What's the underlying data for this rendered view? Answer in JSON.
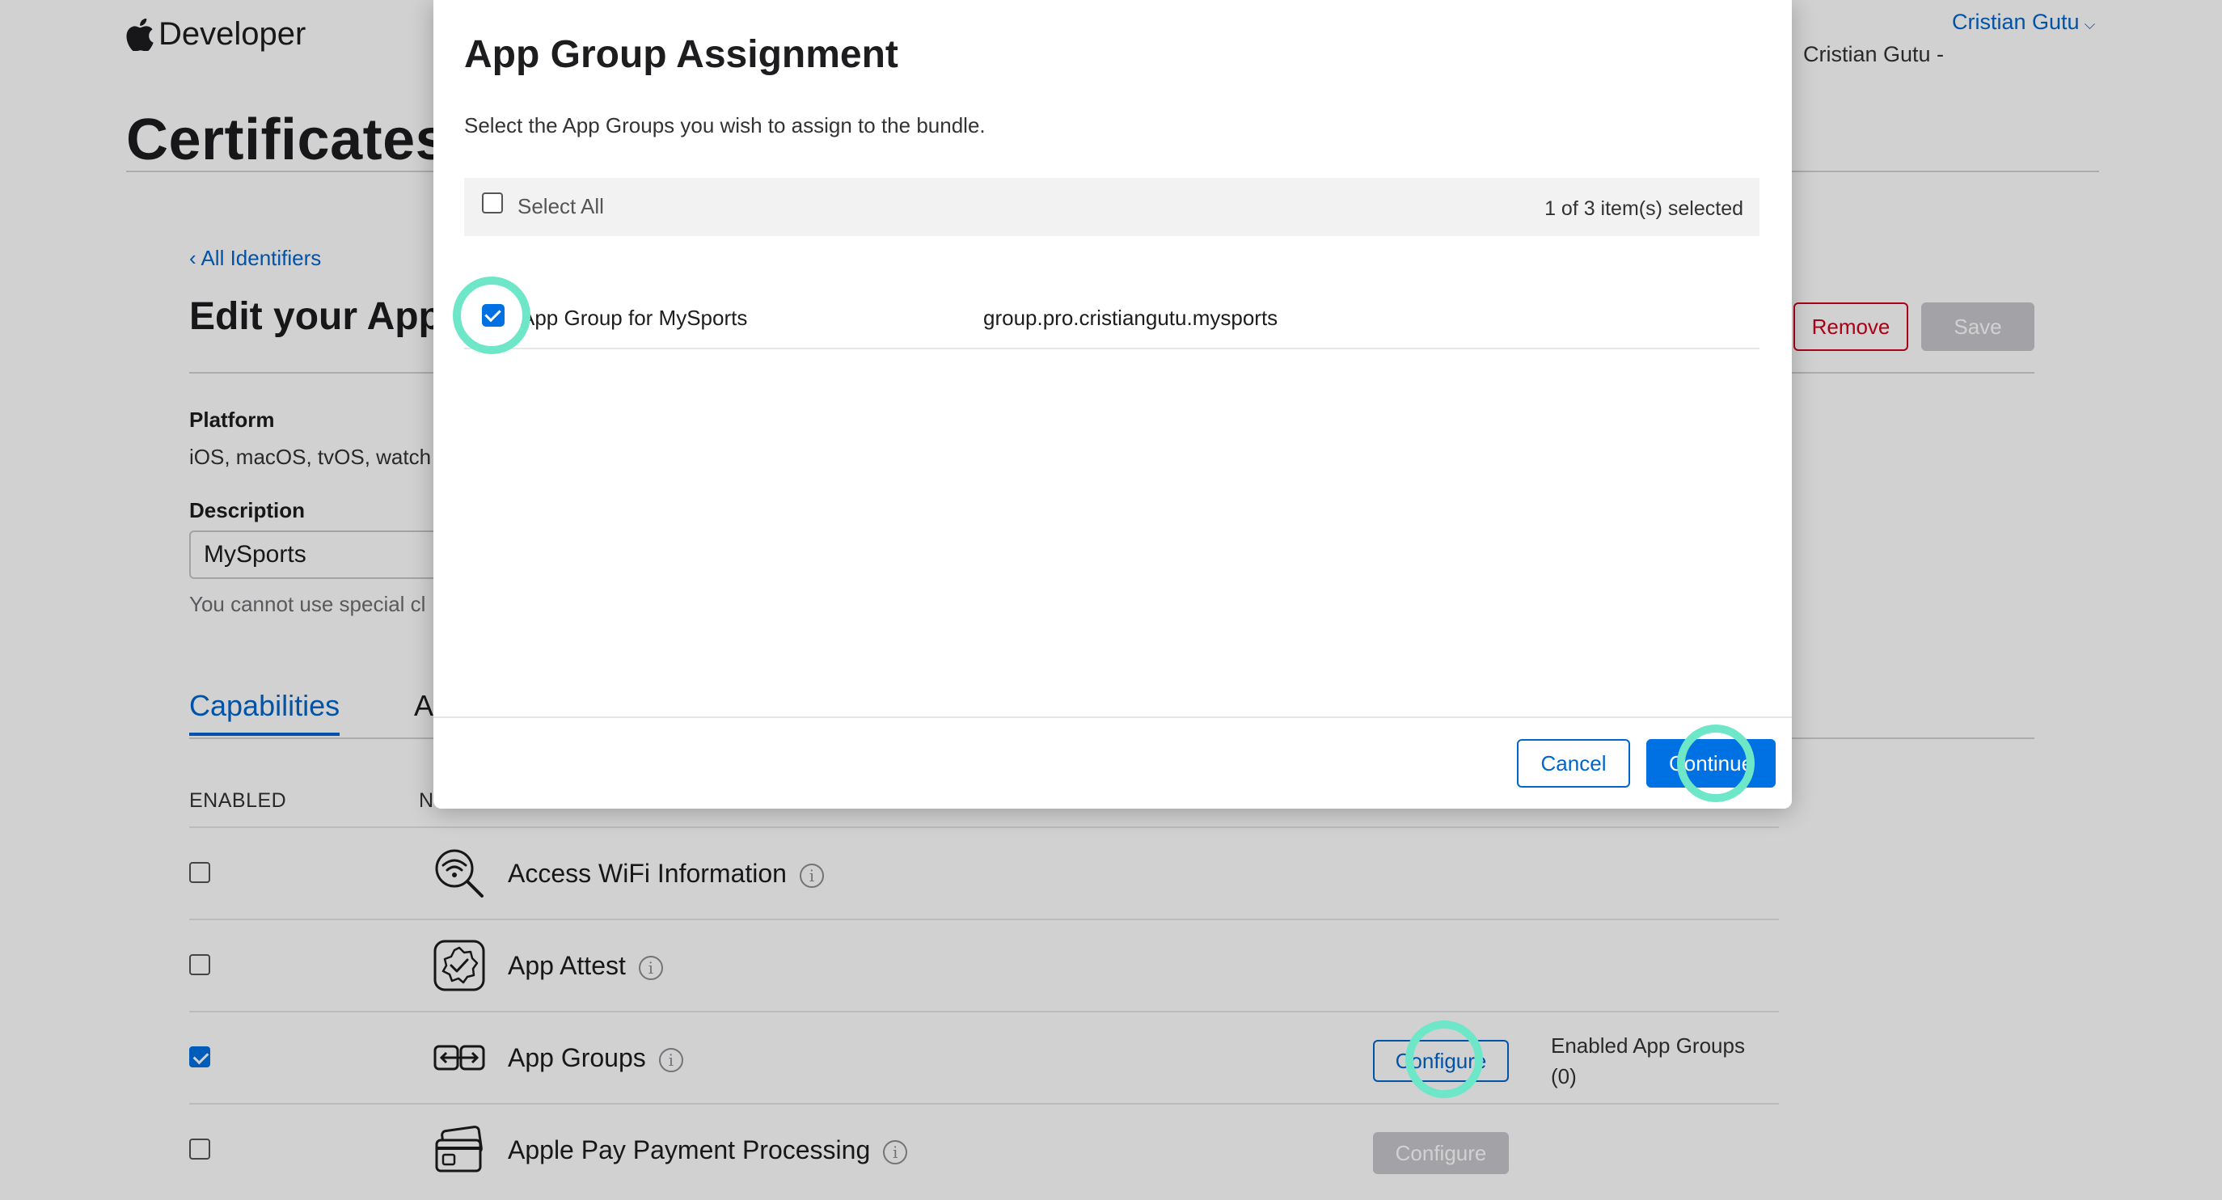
{
  "header": {
    "brand": "Developer",
    "user_name": "Cristian Gutu",
    "user_team": "Cristian Gutu -"
  },
  "page": {
    "title": "Certificates",
    "back_link": "‹ All Identifiers",
    "section_title": "Edit your App",
    "remove_label": "Remove",
    "save_label": "Save",
    "platform_label": "Platform",
    "platform_value": "iOS, macOS, tvOS, watch",
    "description_label": "Description",
    "description_value": "MySports",
    "description_hint": "You cannot use special cl",
    "tabs": [
      {
        "label": "Capabilities",
        "active": true
      },
      {
        "label": "A",
        "active": false
      }
    ],
    "col_enabled": "ENABLED",
    "col_name": "N",
    "capabilities": [
      {
        "name": "Access WiFi Information",
        "enabled": false,
        "icon": "wifi-search-icon"
      },
      {
        "name": "App Attest",
        "enabled": false,
        "icon": "badge-check-icon"
      },
      {
        "name": "App Groups",
        "enabled": true,
        "icon": "app-groups-icon",
        "configure_label": "Configure",
        "configure_state": "active",
        "status_line1": "Enabled App Groups",
        "status_line2": "(0)"
      },
      {
        "name": "Apple Pay Payment Processing",
        "enabled": false,
        "icon": "wallet-card-icon",
        "configure_label": "Configure",
        "configure_state": "disabled"
      }
    ]
  },
  "modal": {
    "title": "App Group Assignment",
    "subtitle": "Select the App Groups you wish to assign to the bundle.",
    "select_all_label": "Select All",
    "selected_count": "1 of 3 item(s) selected",
    "groups": [
      {
        "name": "App Group for MySports",
        "identifier": "group.pro.cristiangutu.mysports",
        "checked": true
      }
    ],
    "cancel_label": "Cancel",
    "continue_label": "Continue"
  },
  "colors": {
    "accent": "#0071e3",
    "link": "#0066cc",
    "danger": "#d0021b",
    "highlight_ring": "#6ee7c8"
  }
}
